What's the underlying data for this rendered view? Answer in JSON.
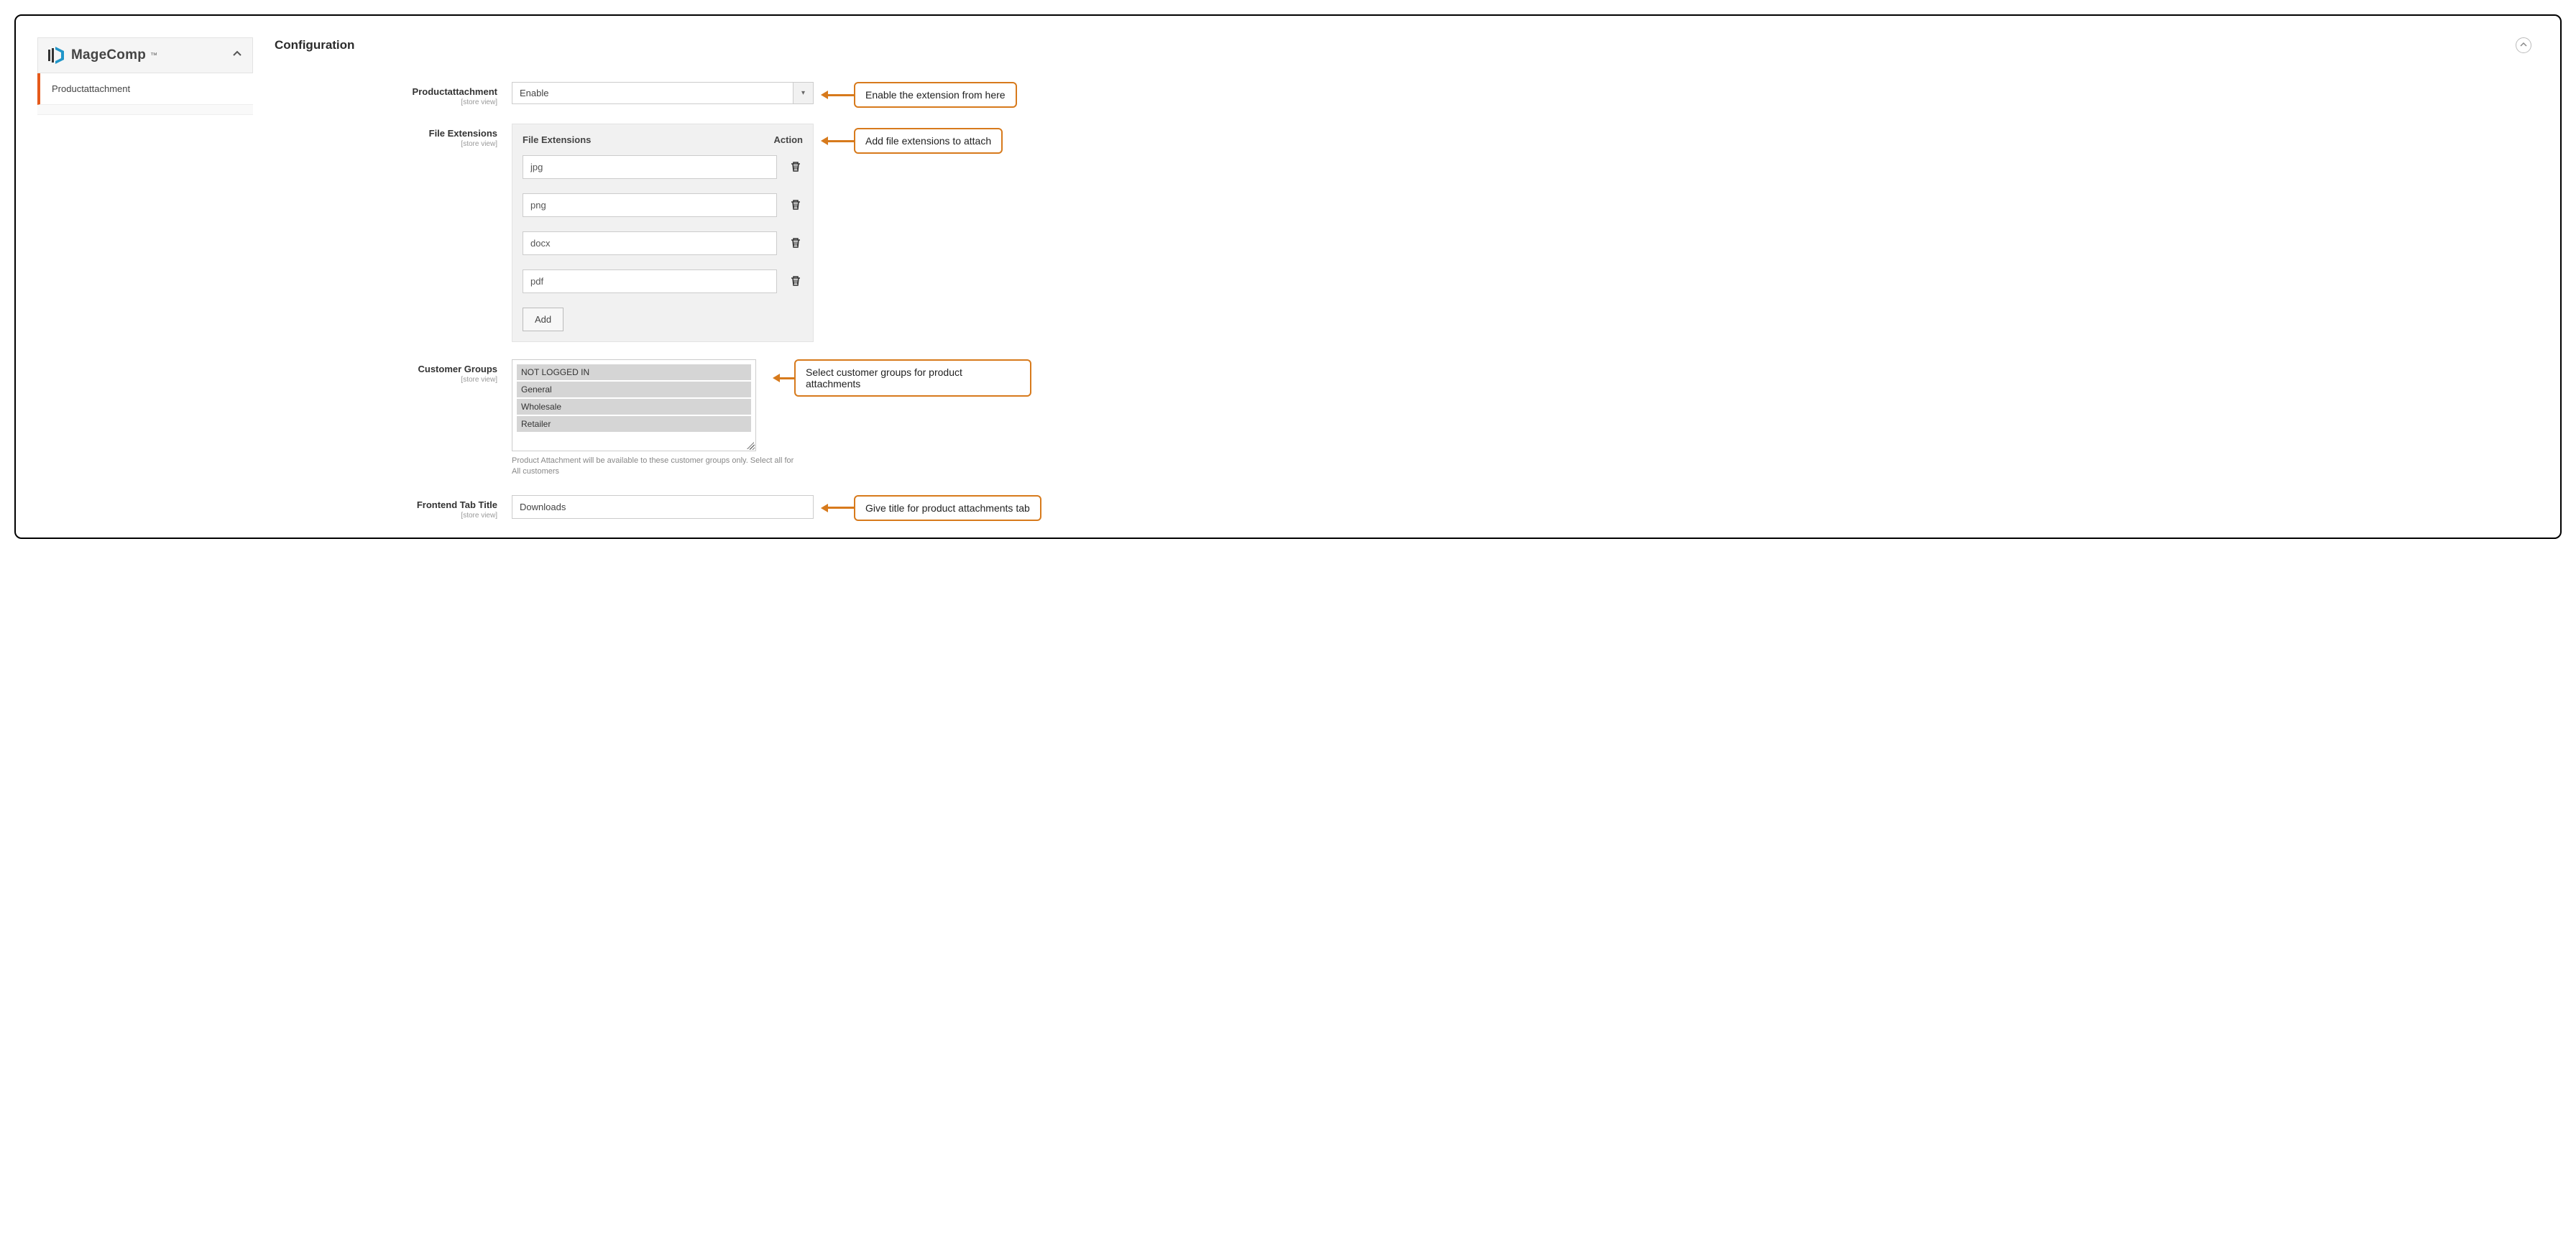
{
  "sidebar": {
    "brand": "MageComp",
    "items": [
      {
        "label": "Productattachment"
      }
    ]
  },
  "page": {
    "title": "Configuration"
  },
  "fields": {
    "productattachment": {
      "label": "Productattachment",
      "scope": "[store view]",
      "value": "Enable"
    },
    "file_extensions": {
      "label": "File Extensions",
      "scope": "[store view]",
      "header_left": "File Extensions",
      "header_right": "Action",
      "rows": [
        "jpg",
        "png",
        "docx",
        "pdf"
      ],
      "add_label": "Add"
    },
    "customer_groups": {
      "label": "Customer Groups",
      "scope": "[store view]",
      "options": [
        "NOT LOGGED IN",
        "General",
        "Wholesale",
        "Retailer"
      ],
      "note": "Product Attachment will be available to these customer groups only. Select all for All customers"
    },
    "frontend_tab_title": {
      "label": "Frontend Tab Title",
      "scope": "[store view]",
      "value": "Downloads"
    }
  },
  "annotations": {
    "a1": "Enable the extension from here",
    "a2": "Add file extensions to attach",
    "a3": "Select customer groups for product attachments",
    "a4": "Give title for product attachments tab"
  }
}
